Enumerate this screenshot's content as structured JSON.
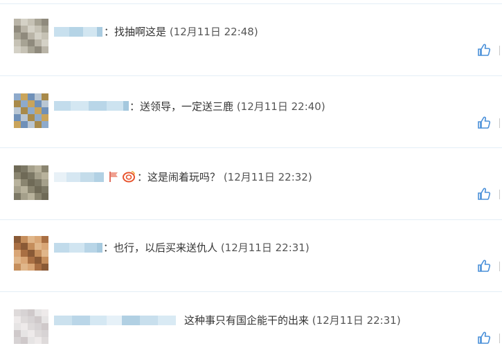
{
  "comments": [
    {
      "separator": "：",
      "text": "找抽啊这是",
      "time": "(12月11日 22:48)",
      "like_icon": "thumbs-up-icon",
      "avatar_colors": [
        "#b9b4a7",
        "#a7a394",
        "#d4d1c6",
        "#8f8a7d",
        "#c6c2b5"
      ]
    },
    {
      "separator": "：",
      "text": "送领导，一定送三鹿",
      "time": "(12月11日 22:40)",
      "like_icon": "thumbs-up-icon",
      "avatar_colors": [
        "#6f90b8",
        "#8eaacb",
        "#b9c6d3",
        "#c9a45b",
        "#a88a4a"
      ]
    },
    {
      "separator": "：",
      "text": "这是闹着玩吗？",
      "time": "(12月11日 22:32)",
      "like_icon": "thumbs-up-icon",
      "badge_icon": "weibo-badge-icon",
      "avatar_colors": [
        "#8a8570",
        "#a5a08b",
        "#6f6a57",
        "#b8b29c",
        "#7c7865"
      ]
    },
    {
      "separator": "：",
      "text": "也行，以后买来送仇人",
      "time": "(12月11日 22:31)",
      "like_icon": "thumbs-up-icon",
      "avatar_colors": [
        "#c58e5c",
        "#a96f43",
        "#e0b68a",
        "#8a5a36",
        "#d9a676"
      ]
    },
    {
      "separator": "",
      "text": "这种事只有国企能干的出来",
      "time": "(12月11日 22:31)",
      "like_icon": "thumbs-up-icon",
      "avatar_colors": [
        "#e6e4e4",
        "#d7d3d4",
        "#eeeaea",
        "#cfc9ca",
        "#dedada"
      ]
    }
  ],
  "colors": {
    "divider": "#e3eef6",
    "blurred_name": "#bcd8e8",
    "like_icon": "#4a90d9"
  }
}
